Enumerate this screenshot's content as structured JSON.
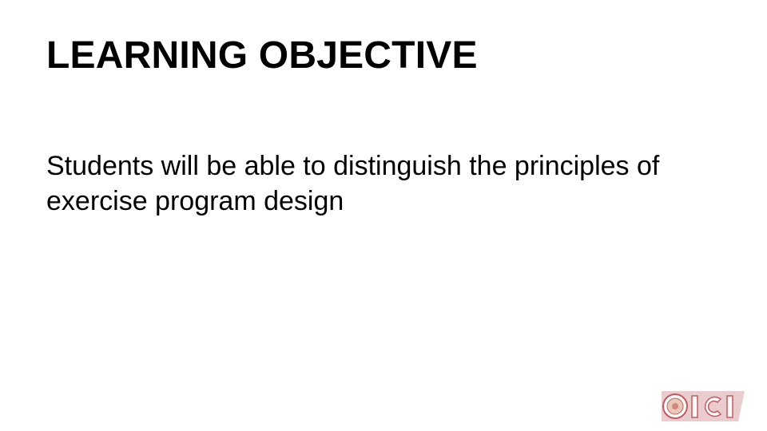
{
  "slide": {
    "title": "LEARNING OBJECTIVE",
    "body": "Students will be able to distinguish the principles of exercise program design"
  },
  "logo": {
    "text": "ICI",
    "colors": {
      "fill": "#d9a3a5",
      "stroke": "#c25a5f",
      "seal": "#e8c9b8"
    }
  }
}
